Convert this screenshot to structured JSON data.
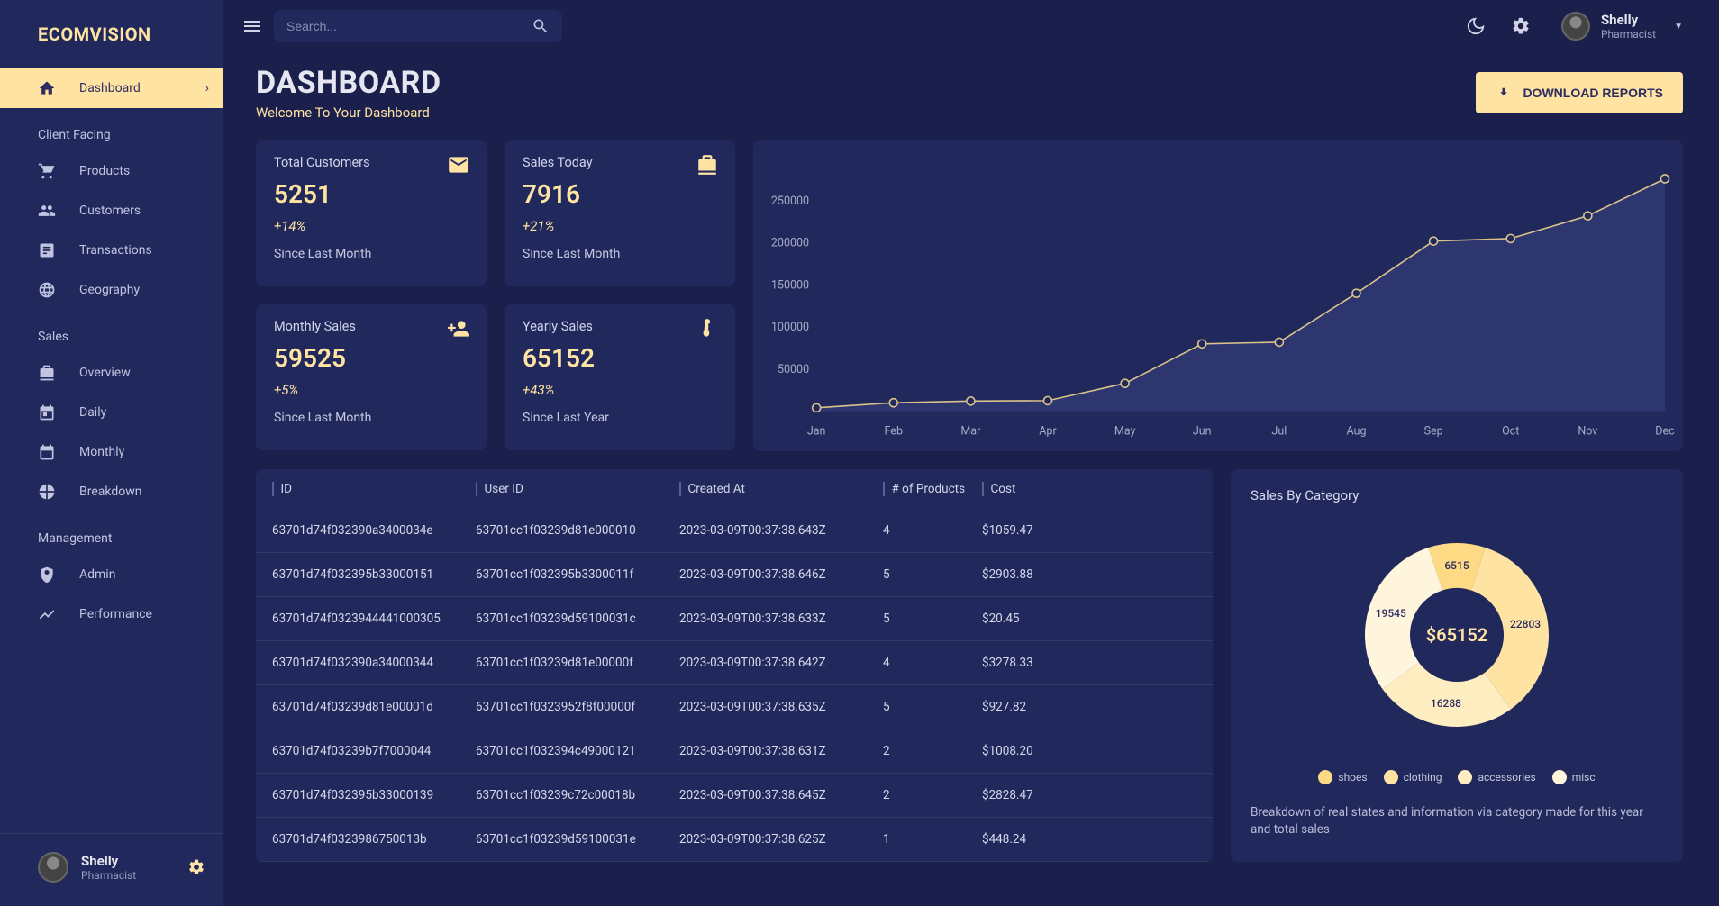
{
  "brand": "ECOMVISION",
  "search": {
    "placeholder": "Search..."
  },
  "user": {
    "name": "Shelly",
    "role": "Pharmacist"
  },
  "sidebar": {
    "items": [
      {
        "label": "Dashboard",
        "active": true
      },
      {
        "section": "Client Facing"
      },
      {
        "label": "Products"
      },
      {
        "label": "Customers"
      },
      {
        "label": "Transactions"
      },
      {
        "label": "Geography"
      },
      {
        "section": "Sales"
      },
      {
        "label": "Overview"
      },
      {
        "label": "Daily"
      },
      {
        "label": "Monthly"
      },
      {
        "label": "Breakdown"
      },
      {
        "section": "Management"
      },
      {
        "label": "Admin"
      },
      {
        "label": "Performance"
      }
    ]
  },
  "page": {
    "title": "DASHBOARD",
    "subtitle": "Welcome To Your Dashboard",
    "download": "DOWNLOAD REPORTS"
  },
  "stats": [
    {
      "label": "Total Customers",
      "value": "5251",
      "change": "+14%",
      "since": "Since Last Month"
    },
    {
      "label": "Sales Today",
      "value": "7916",
      "change": "+21%",
      "since": "Since Last Month"
    },
    {
      "label": "Monthly Sales",
      "value": "59525",
      "change": "+5%",
      "since": "Since Last Month"
    },
    {
      "label": "Yearly Sales",
      "value": "65152",
      "change": "+43%",
      "since": "Since Last Year"
    }
  ],
  "chart_data": {
    "type": "line",
    "categories": [
      "Jan",
      "Feb",
      "Mar",
      "Apr",
      "May",
      "Jun",
      "Jul",
      "Aug",
      "Sep",
      "Oct",
      "Nov",
      "Dec"
    ],
    "values": [
      4000,
      10000,
      12000,
      12500,
      33000,
      80000,
      82000,
      140000,
      202000,
      205000,
      232000,
      276000
    ],
    "ylim": [
      0,
      300000
    ],
    "yticks": [
      50000,
      100000,
      150000,
      200000,
      250000
    ]
  },
  "table": {
    "columns": [
      "ID",
      "User ID",
      "Created At",
      "# of Products",
      "Cost"
    ],
    "rows": [
      [
        "63701d74f032390a3400034e",
        "63701cc1f03239d81e000010",
        "2023-03-09T00:37:38.643Z",
        "4",
        "$1059.47"
      ],
      [
        "63701d74f032395b33000151",
        "63701cc1f032395b3300011f",
        "2023-03-09T00:37:38.646Z",
        "5",
        "$2903.88"
      ],
      [
        "63701d74f0323944441000305",
        "63701cc1f03239d59100031c",
        "2023-03-09T00:37:38.633Z",
        "5",
        "$20.45"
      ],
      [
        "63701d74f032390a34000344",
        "63701cc1f03239d81e00000f",
        "2023-03-09T00:37:38.642Z",
        "4",
        "$3278.33"
      ],
      [
        "63701d74f03239d81e00001d",
        "63701cc1f0323952f8f00000f",
        "2023-03-09T00:37:38.635Z",
        "5",
        "$927.82"
      ],
      [
        "63701d74f03239b7f7000044",
        "63701cc1f032394c49000121",
        "2023-03-09T00:37:38.631Z",
        "2",
        "$1008.20"
      ],
      [
        "63701d74f032395b33000139",
        "63701cc1f03239c72c00018b",
        "2023-03-09T00:37:38.645Z",
        "2",
        "$2828.47"
      ],
      [
        "63701d74f0323986750013b",
        "63701cc1f03239d59100031e",
        "2023-03-09T00:37:38.625Z",
        "1",
        "$448.24"
      ]
    ]
  },
  "donut": {
    "title": "Sales By Category",
    "center": "$65152",
    "desc": "Breakdown of real states and information via category made for this year and total sales",
    "legend": [
      "shoes",
      "clothing",
      "accessories",
      "misc"
    ],
    "colors": [
      "#ffda85",
      "#ffe3a3",
      "#ffedc2",
      "#fff5dd"
    ],
    "data": [
      {
        "label": "shoes",
        "value": 6515
      },
      {
        "label": "clothing",
        "value": 22803
      },
      {
        "label": "accessories",
        "value": 16288
      },
      {
        "label": "misc",
        "value": 19545
      }
    ]
  }
}
